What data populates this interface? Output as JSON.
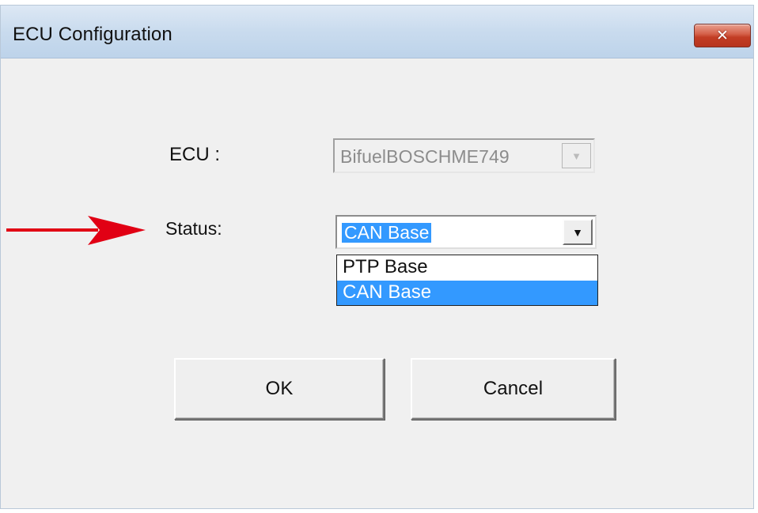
{
  "window": {
    "title": "ECU Configuration",
    "close_symbol": "✕"
  },
  "form": {
    "ecu": {
      "label": "ECU :",
      "value": "BifuelBOSCHME749",
      "arrow_symbol": "▼"
    },
    "status": {
      "label": "Status:",
      "selected_value": "CAN Base",
      "arrow_symbol": "▼",
      "options": [
        {
          "label": "PTP Base"
        },
        {
          "label": "CAN Base"
        }
      ]
    }
  },
  "actions": {
    "ok_label": "OK",
    "cancel_label": "Cancel"
  },
  "colors": {
    "arrow": "#e10014",
    "selection": "#3399ff"
  }
}
